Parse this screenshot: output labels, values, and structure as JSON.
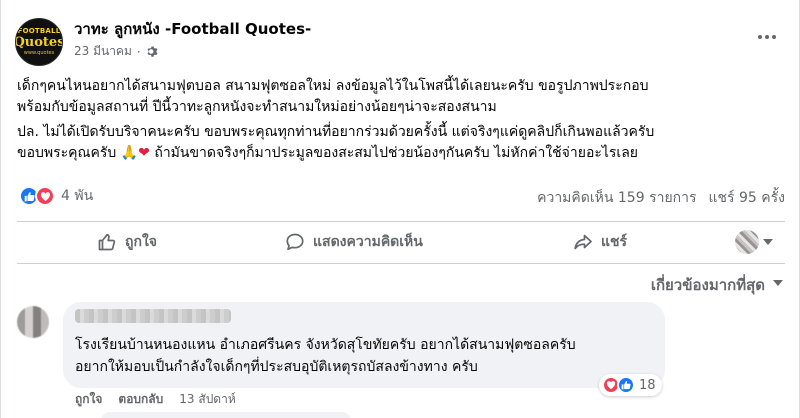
{
  "page": {
    "name": "วาทะ ลูกหนัง -Football Quotes-",
    "avatar_text": [
      "FOOTBALL",
      "Quotes",
      "www.quotes"
    ],
    "date": "23 มีนาคม",
    "separator": "·",
    "audience_icon": "gear-icon"
  },
  "post": {
    "paragraph1": [
      "เด็กๆคนไหนอยากได้สนามฟุตบอล สนามฟุตซอลใหม่ ลงข้อมูลไว้ในโพสนี้ได้เลยนะครับ ขอรูปภาพประกอบ",
      "พร้อมกับข้อมูลสถานที่ ปีนี้วาทะลูกหนังจะทำสนามใหม่อย่างน้อยๆน่าจะสองสนาม"
    ],
    "paragraph2": [
      "ปล. ไม่ได้เปิดรับบริจาคนะครับ ขอบพระคุณทุกท่านที่อยากร่วมด้วยครั้งนี้ แต่จริงๆแค่ดูคลิปก็เกินพอแล้วครับ",
      "ขอบพระคุณครับ",
      "🙏",
      "❤",
      "ถ้ามันขาดจริงๆก็มาประมูลของสะสมไปช่วยน้องๆกันครับ ไม่หักค่าใช้จ่ายอะไรเลย"
    ]
  },
  "stats": {
    "reactions_count": "4 พัน",
    "comments": "ความคิดเห็น 159 รายการ",
    "shares": "แชร์ 95 ครั้ง"
  },
  "actions": {
    "like": "ถูกใจ",
    "comment": "แสดงความคิดเห็น",
    "share": "แชร์"
  },
  "sort_label": "เกี่ยวข้องมากที่สุด",
  "comment": {
    "line1": "โรงเรียนบ้านหนองแหน อำเภอศรีนคร จังหวัดสุโขทัยครับ อยากได้สนามฟุตซอลครับ",
    "line2": "อยากให้มอบเป็นกำลังใจเด็กๆที่ประสบอุบัติเหตุรถบัสลงข้างทาง ครับ",
    "reaction_count": "18",
    "like": "ถูกใจ",
    "reply": "ตอบกลับ",
    "time": "13 สัปดาห์"
  },
  "colors": {
    "like_blue": "#1877f2",
    "love_red": "#f33e58",
    "muted": "#65676b",
    "bubble": "#f0f2f5"
  }
}
